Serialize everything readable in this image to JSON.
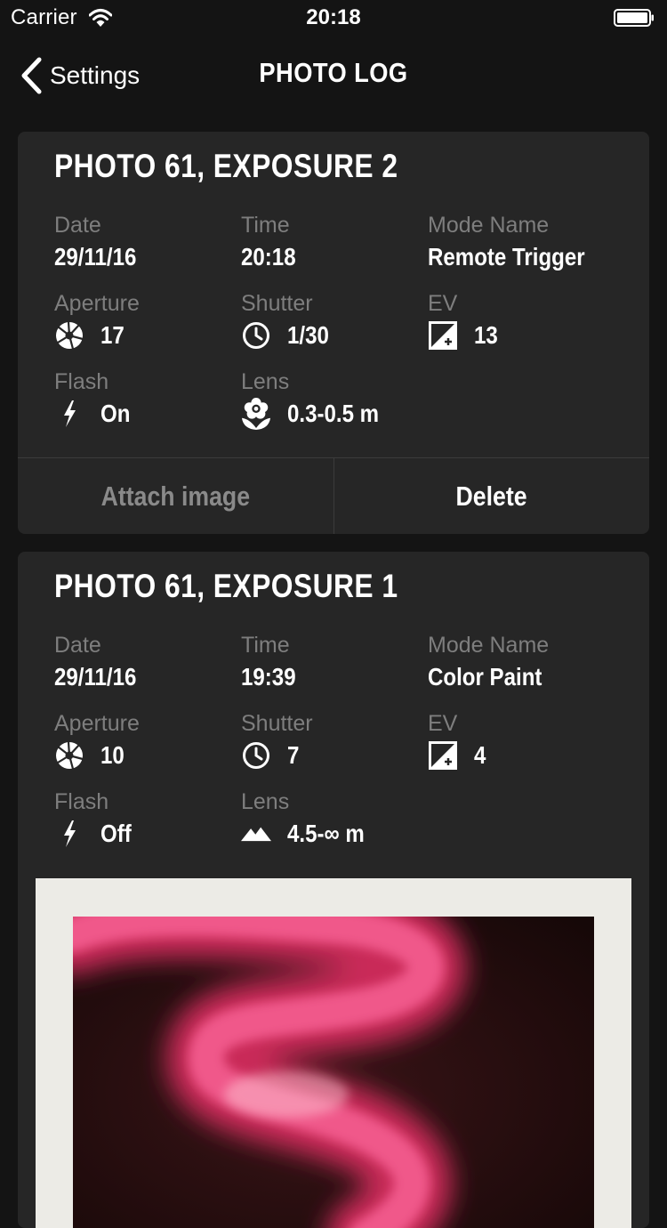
{
  "status_bar": {
    "carrier": "Carrier",
    "time": "20:18"
  },
  "nav": {
    "back_label": "Settings",
    "title": "PHOTO LOG"
  },
  "labels": {
    "date": "Date",
    "time": "Time",
    "mode_name": "Mode Name",
    "aperture": "Aperture",
    "shutter": "Shutter",
    "ev": "EV",
    "flash": "Flash",
    "lens": "Lens"
  },
  "entries": [
    {
      "title": "PHOTO 61, EXPOSURE 2",
      "date": "29/11/16",
      "time": "20:18",
      "mode_name": "Remote Trigger",
      "aperture": "17",
      "shutter": "1/30",
      "ev": "13",
      "flash": "On",
      "lens": "0.3-0.5 m",
      "lens_icon": "flower-icon",
      "actions": {
        "attach": "Attach image",
        "delete": "Delete"
      }
    },
    {
      "title": "PHOTO 61, EXPOSURE 1",
      "date": "29/11/16",
      "time": "19:39",
      "mode_name": "Color Paint",
      "aperture": "10",
      "shutter": "7",
      "ev": "4",
      "flash": "Off",
      "lens": "4.5-∞ m",
      "lens_icon": "mountain-icon",
      "attached_image": "polaroid-photo"
    }
  ],
  "colors": {
    "background": "#141414",
    "card": "#262626",
    "label": "#7e7e7e",
    "muted_action": "#8a8a8a",
    "photo_frame": "#ecebe6",
    "photo_light": "#e8356f"
  }
}
